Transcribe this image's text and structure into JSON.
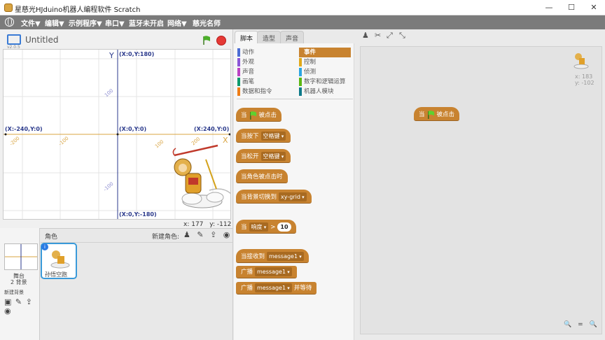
{
  "window": {
    "title": "星慈光HJduino机器人编程软件 Scratch",
    "buttons": [
      "—",
      "☐",
      "✕"
    ]
  },
  "menu": [
    "文件▼",
    "编辑▼",
    "示例程序▼",
    "串口▼",
    "蓝牙未开启",
    "网络▼",
    "慈光名师"
  ],
  "stage": {
    "version": "v2.0.5",
    "project_title": "Untitled",
    "axis_y_label": "Y",
    "axis_x_label": "X",
    "labels": {
      "top": "(X:0,Y:180)",
      "bottom": "(X:0,Y:-180)",
      "left": "(X:-240,Y:0)",
      "right": "(X:240,Y:0)",
      "center": "(X:0,Y:0)"
    },
    "ticks": [
      "100",
      "-100",
      "-200",
      "-100",
      "100",
      "200"
    ],
    "mouse_x_label": "x:",
    "mouse_x": "177",
    "mouse_y_label": "y:",
    "mouse_y": "-112"
  },
  "sprites": {
    "header": "角色",
    "new_sprite": "新建角色:",
    "stage_name": "舞台",
    "stage_bg_count": "2 背景",
    "new_backdrop": "新建背景",
    "sprite_name": "孙悟空跑"
  },
  "tabs": [
    "脚本",
    "造型",
    "声音"
  ],
  "categories": {
    "left": [
      {
        "label": "动作",
        "color": "#4a6cd4"
      },
      {
        "label": "外观",
        "color": "#8a55d7"
      },
      {
        "label": "声音",
        "color": "#bb42c3"
      },
      {
        "label": "画笔",
        "color": "#0e9a6c"
      },
      {
        "label": "数据和指令",
        "color": "#ee7d16"
      }
    ],
    "right": [
      {
        "label": "事件",
        "color": "#c88330"
      },
      {
        "label": "控制",
        "color": "#e1a91a"
      },
      {
        "label": "侦测",
        "color": "#2ca5e2"
      },
      {
        "label": "数字和逻辑运算",
        "color": "#5cb712"
      },
      {
        "label": "机器人模块",
        "color": "#0e7a8a"
      }
    ]
  },
  "blocks": {
    "when_flag_a": "当",
    "when_flag_b": "被点击",
    "key_pressed": "当按下",
    "key_pressed_val": "空格键",
    "key_released": "当松开",
    "key_released_val": "空格键",
    "sprite_clicked": "当角色被点击时",
    "backdrop_switch": "当背景切换到",
    "backdrop_val": "xy-grid",
    "when_a": "当",
    "loudness": "响度",
    "gt": ">",
    "loud_val": "10",
    "receive": "当接收到",
    "receive_val": "message1",
    "broadcast": "广播",
    "broadcast_val": "message1",
    "broadcast_wait": "广播",
    "broadcast_wait_val": "message1",
    "broadcast_wait_b": "并等待"
  },
  "workspace": {
    "script_a": "当",
    "script_b": "被点击",
    "sprite_x": "x: 183",
    "sprite_y": "y: -102",
    "zoom": [
      "🔍",
      "=",
      "🔍"
    ]
  },
  "colors": {
    "event": "#c88330",
    "menubar": "#7b7b7b"
  }
}
